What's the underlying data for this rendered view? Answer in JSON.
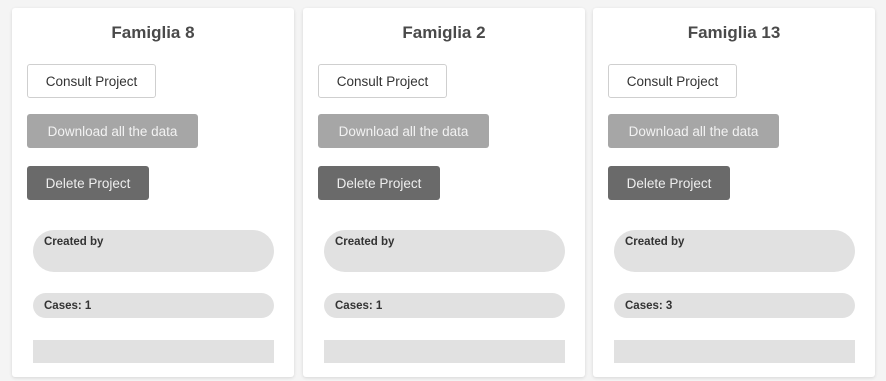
{
  "projects": [
    {
      "title": "Famiglia 8",
      "consult_label": "Consult Project",
      "download_label": "Download all the data",
      "delete_label": "Delete Project",
      "created_by_label": "Created by",
      "cases_label": "Cases: 1"
    },
    {
      "title": "Famiglia 2",
      "consult_label": "Consult Project",
      "download_label": "Download all the data",
      "delete_label": "Delete Project",
      "created_by_label": "Created by",
      "cases_label": "Cases: 1"
    },
    {
      "title": "Famiglia 13",
      "consult_label": "Consult Project",
      "download_label": "Download all the data",
      "delete_label": "Delete Project",
      "created_by_label": "Created by",
      "cases_label": "Cases: 3"
    }
  ],
  "colors": {
    "download_bg": "#a6a6a6",
    "delete_bg": "#6a6a6a",
    "pill_bg": "#e1e1e1"
  }
}
